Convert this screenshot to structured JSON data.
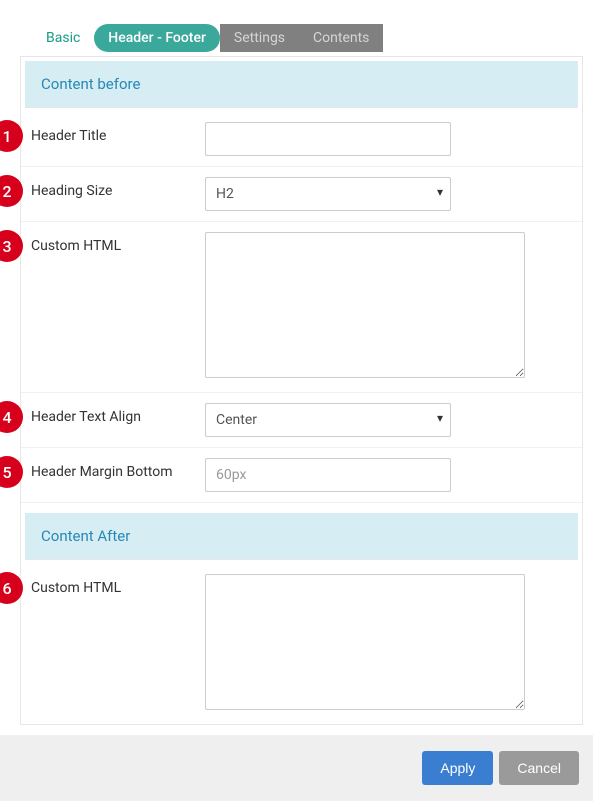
{
  "tabs": {
    "basic": "Basic",
    "header_footer": "Header - Footer",
    "settings": "Settings",
    "contents": "Contents"
  },
  "sections": {
    "content_before": "Content before",
    "content_after": "Content After"
  },
  "fields": {
    "header_title": {
      "label": "Header Title",
      "value": ""
    },
    "heading_size": {
      "label": "Heading Size",
      "value": "H2"
    },
    "custom_html_before": {
      "label": "Custom HTML",
      "value": ""
    },
    "header_text_align": {
      "label": "Header Text Align",
      "value": "Center"
    },
    "header_margin_bottom": {
      "label": "Header Margin Bottom",
      "placeholder": "60px",
      "value": ""
    },
    "custom_html_after": {
      "label": "Custom HTML",
      "value": ""
    }
  },
  "badges": {
    "b1": "1",
    "b2": "2",
    "b3": "3",
    "b4": "4",
    "b5": "5",
    "b6": "6"
  },
  "buttons": {
    "apply": "Apply",
    "cancel": "Cancel"
  }
}
